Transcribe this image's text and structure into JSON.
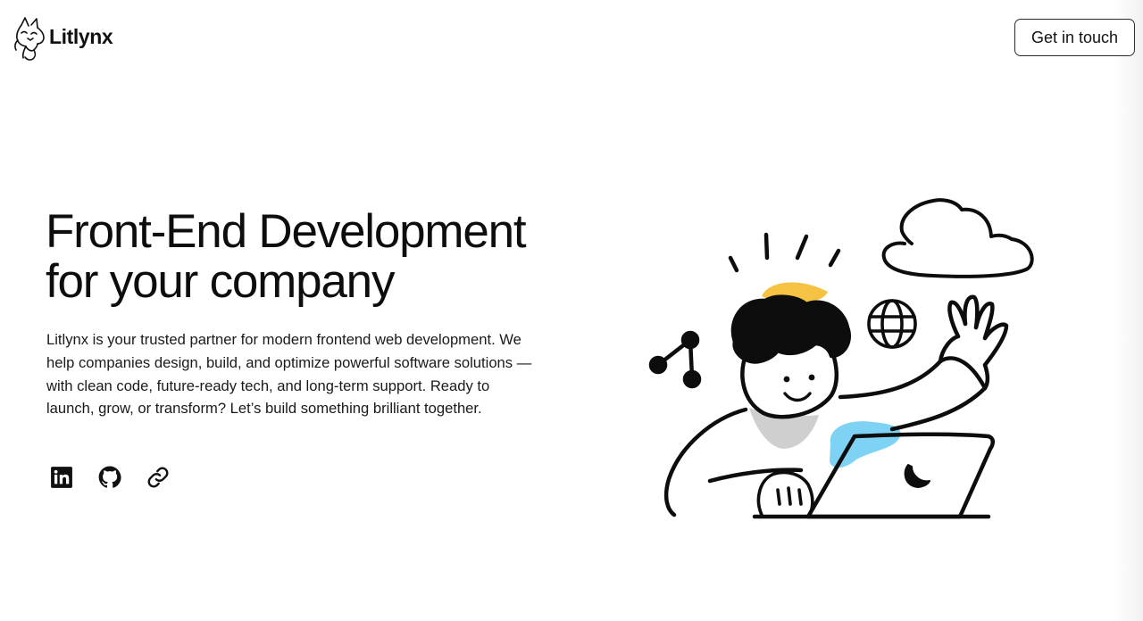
{
  "header": {
    "brand": "Litlynx",
    "cta_label": "Get in touch"
  },
  "hero": {
    "title_line1": "Front-End Development",
    "title_line2": "for your company",
    "description": "Litlynx is your trusted partner for modern frontend web development. We help companies design, build, and optimize powerful software solutions — with clean code, future-ready tech, and long-term support. Ready to launch, grow, or transform? Let’s build something brilliant together."
  },
  "socials": [
    {
      "icon": "linkedin-icon"
    },
    {
      "icon": "github-icon"
    },
    {
      "icon": "link-icon"
    }
  ],
  "illustration": {
    "accent_yellow": "#f6c244",
    "accent_blue": "#7ed3f5",
    "accent_gray": "#cfcfcf"
  }
}
